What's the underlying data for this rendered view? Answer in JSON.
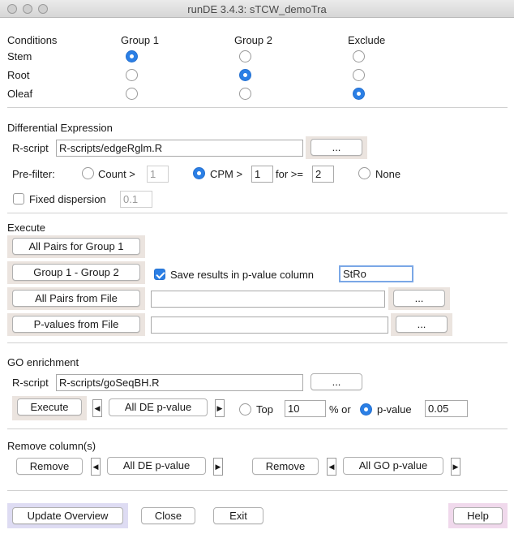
{
  "window": {
    "title": "runDE 3.4.3:   sTCW_demoTra"
  },
  "conditions": {
    "header": "Conditions",
    "col_group1": "Group 1",
    "col_group2": "Group 2",
    "col_exclude": "Exclude",
    "rows": [
      {
        "label": "Stem",
        "selected": "group1"
      },
      {
        "label": "Root",
        "selected": "group2"
      },
      {
        "label": "Oleaf",
        "selected": "exclude"
      }
    ]
  },
  "de": {
    "header": "Differential Expression",
    "rscript_label": "R-script",
    "rscript_value": "R-scripts/edgeRglm.R",
    "browse": "...",
    "prefilter_label": "Pre-filter:",
    "count_label": "Count >",
    "count_value": "1",
    "cpm_label": "CPM >",
    "cpm_value": "1",
    "for_label": "for >=",
    "for_value": "2",
    "none_label": "None",
    "prefilter_selected": "cpm",
    "fixed_disp_label": "Fixed dispersion",
    "fixed_disp_checked": false,
    "fixed_disp_value": "0.1"
  },
  "execute": {
    "header": "Execute",
    "all_pairs_group1": "All Pairs for Group 1",
    "group1_group2": "Group 1 - Group 2",
    "save_results_label": "Save results in p-value column",
    "save_results_checked": true,
    "pvalue_column": "StRo",
    "all_pairs_file": "All Pairs from File",
    "all_pairs_file_path": "",
    "pvalues_file": "P-values from File",
    "pvalues_file_path": "",
    "browse": "..."
  },
  "go": {
    "header": "GO enrichment",
    "rscript_label": "R-script",
    "rscript_value": "R-scripts/goSeqBH.R",
    "browse": "...",
    "execute": "Execute",
    "de_select": "All DE p-value",
    "top_label": "Top",
    "top_value": "10",
    "pct_or": "% or",
    "pvalue_label": "p-value",
    "pvalue_value": "0.05",
    "selected": "pvalue"
  },
  "remove": {
    "header": "Remove column(s)",
    "remove1": "Remove",
    "select1": "All DE p-value",
    "remove2": "Remove",
    "select2": "All GO p-value"
  },
  "footer": {
    "update": "Update Overview",
    "close": "Close",
    "exit": "Exit",
    "help": "Help"
  },
  "colors": {
    "accent": "#2b7fe5",
    "panel_tan": "#ebe4df",
    "panel_lavender": "#dedcf3",
    "panel_pink": "#f0d9ec"
  },
  "icons": {
    "arrow_left": "left-arrow-icon",
    "arrow_right": "right-arrow-icon"
  }
}
